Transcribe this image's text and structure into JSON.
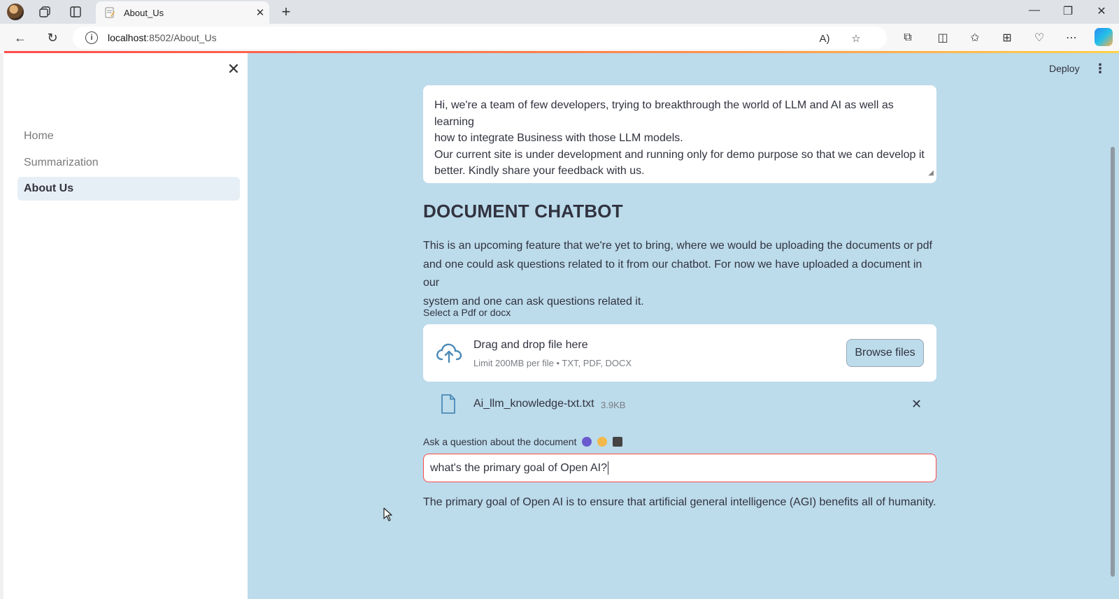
{
  "browser": {
    "tab_title": "About_Us",
    "url_host": "localhost",
    "url_path": ":8502/About_Us"
  },
  "sidebar": {
    "items": [
      {
        "label": "Home",
        "active": false
      },
      {
        "label": "Summarization",
        "active": false
      },
      {
        "label": "About Us",
        "active": true
      }
    ]
  },
  "header": {
    "deploy_label": "Deploy"
  },
  "about": {
    "line1": "Hi, we're a team of few developers, trying to breakthrough the world of LLM and AI as well as learning",
    "line2": "how to integrate Business with those LLM models.",
    "line3": "Our current site is under development and running only for demo purpose so that we can develop it",
    "line4": "better. Kindly share your feedback with us."
  },
  "chatbot": {
    "heading": "DOCUMENT CHATBOT",
    "para_line1": "This is an upcoming feature that we're yet to bring, where we would be uploading the documents or pdf",
    "para_line2": "and one could ask questions related to it from our chatbot. For now we have uploaded a document in our",
    "para_line3": "system and one can ask questions related it.",
    "uploader_label": "Select a Pdf or docx",
    "dropzone_title": "Drag and drop file here",
    "dropzone_limit": "Limit 200MB per file • TXT, PDF, DOCX",
    "browse_label": "Browse files",
    "file_name": "Ai_llm_knowledge-txt.txt",
    "file_size": "3.9KB",
    "question_label": "Ask a question about the document",
    "question_value": "what's the primary goal of Open AI?",
    "answer": "The primary goal of Open AI is to ensure that artificial general intelligence (AGI) benefits all of humanity."
  },
  "colors": {
    "main_bg": "#bcdbeb",
    "accent": "#ff4b4b",
    "text": "#31333f",
    "sidebar_active_bg": "#e6eff6"
  }
}
